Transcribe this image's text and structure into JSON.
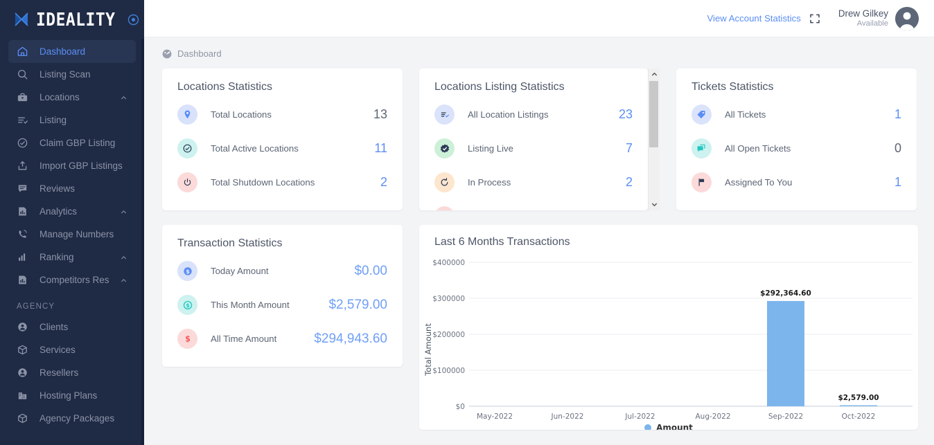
{
  "brand": {
    "name": "IDEALITY",
    "logo_icon": "ideality-x-logo",
    "target_icon": "target-icon"
  },
  "sidebar": {
    "items": [
      {
        "label": "Dashboard",
        "icon": "home-icon",
        "active": true,
        "caret": false
      },
      {
        "label": "Listing Scan",
        "icon": "search-icon",
        "active": false,
        "caret": false
      },
      {
        "label": "Locations",
        "icon": "briefcase-icon",
        "active": false,
        "caret": true
      },
      {
        "label": "Listing",
        "icon": "list-check-icon",
        "active": false,
        "caret": false
      },
      {
        "label": "Claim GBP Listing",
        "icon": "check-circle-icon",
        "active": false,
        "caret": false
      },
      {
        "label": "Import GBP Listings",
        "icon": "upload-box-icon",
        "active": false,
        "caret": false
      },
      {
        "label": "Reviews",
        "icon": "chat-icon",
        "active": false,
        "caret": false
      },
      {
        "label": "Analytics",
        "icon": "bar-chart-icon",
        "active": false,
        "caret": true
      },
      {
        "label": "Manage Numbers",
        "icon": "phone-icon",
        "active": false,
        "caret": false
      },
      {
        "label": "Ranking",
        "icon": "chart-bars-icon",
        "active": false,
        "caret": true
      },
      {
        "label": "Competitors Research",
        "icon": "report-icon",
        "active": false,
        "caret": true
      }
    ],
    "section_label": "AGENCY",
    "agency_items": [
      {
        "label": "Clients",
        "icon": "user-circle-icon",
        "caret": false
      },
      {
        "label": "Services",
        "icon": "box-icon",
        "caret": false
      },
      {
        "label": "Resellers",
        "icon": "user-circle-icon",
        "caret": false
      },
      {
        "label": "Hosting Plans",
        "icon": "server-building-icon",
        "caret": false
      },
      {
        "label": "Agency Packages",
        "icon": "box-icon",
        "caret": false
      }
    ]
  },
  "topbar": {
    "account_stats_label": "View Account Statistics",
    "expand_icon": "fullscreen-expand-icon",
    "user_name": "Drew Gilkey",
    "user_status": "Available",
    "avatar_icon": "user-avatar-icon"
  },
  "breadcrumb": {
    "icon": "dashboard-icon",
    "label": "Dashboard"
  },
  "cards": {
    "locations_statistics": {
      "title": "Locations Statistics",
      "rows": [
        {
          "label": "Total Locations",
          "value": "13",
          "icon": "map-pin-icon",
          "badge_bg": "#d9e2fb",
          "icon_color": "#5b8ef5",
          "value_color": "#4d5668"
        },
        {
          "label": "Total Active Locations",
          "value": "11",
          "icon": "check-circle-icon",
          "badge_bg": "#cdf2ef",
          "icon_color": "#2b3a55",
          "value_color": "#5b8ef5"
        },
        {
          "label": "Total Shutdown Locations",
          "value": "2",
          "icon": "power-icon",
          "badge_bg": "#fbdad9",
          "icon_color": "#2b3a55",
          "value_color": "#5b8ef5"
        }
      ]
    },
    "locations_listing_statistics": {
      "title": "Locations Listing Statistics",
      "rows": [
        {
          "label": "All Location Listings",
          "value": "23",
          "icon": "list-check-icon",
          "badge_bg": "#dbe3fb",
          "icon_color": "#2b3a55",
          "value_color": "#5b8ef5"
        },
        {
          "label": "Listing Live",
          "value": "7",
          "icon": "badge-check-icon",
          "badge_bg": "#cdf0d8",
          "icon_color": "#2b3a55",
          "value_color": "#5b8ef5"
        },
        {
          "label": "In Process",
          "value": "2",
          "icon": "refresh-icon",
          "badge_bg": "#fde6cd",
          "icon_color": "#2b3a55",
          "value_color": "#5b8ef5"
        },
        {
          "label": "",
          "value": "",
          "icon": "partial-row-icon",
          "badge_bg": "#fbdad9",
          "icon_color": "#2b3a55",
          "value_color": "#5b8ef5"
        }
      ],
      "scrollbar": {
        "up_icon": "chevron-up-icon",
        "down_icon": "chevron-down-icon"
      }
    },
    "tickets_statistics": {
      "title": "Tickets Statistics",
      "rows": [
        {
          "label": "All Tickets",
          "value": "1",
          "icon": "tag-icon",
          "badge_bg": "#dbe3fb",
          "icon_color": "#5b8ef5",
          "value_color": "#5b8ef5"
        },
        {
          "label": "All Open Tickets",
          "value": "0",
          "icon": "chat-bubbles-icon",
          "badge_bg": "#cdf2ef",
          "icon_color": "#22c7c0",
          "value_color": "#4d5668"
        },
        {
          "label": "Assigned To You",
          "value": "1",
          "icon": "flag-icon",
          "badge_bg": "#fbdad9",
          "icon_color": "#2b3a55",
          "value_color": "#5b8ef5"
        }
      ]
    },
    "transaction_statistics": {
      "title": "Transaction Statistics",
      "rows": [
        {
          "label": "Today Amount",
          "value": "$0.00",
          "icon": "dollar-circle-icon",
          "badge_bg": "#d9e2fb",
          "icon_color": "#5b8ef5",
          "value_color": "#6f9ff7"
        },
        {
          "label": "This Month Amount",
          "value": "$2,579.00",
          "icon": "dollar-circle-icon",
          "badge_bg": "#cdf2ef",
          "icon_color": "#22c7c0",
          "value_color": "#6f9ff7"
        },
        {
          "label": "All Time Amount",
          "value": "$294,943.60",
          "icon": "dollar-sign-icon",
          "badge_bg": "#fbdad9",
          "icon_color": "#f4565c",
          "value_color": "#6f9ff7"
        }
      ]
    }
  },
  "chart_data": {
    "type": "bar",
    "title": "Last 6 Months Transactions",
    "categories": [
      "May-2022",
      "Jun-2022",
      "Jul-2022",
      "Aug-2022",
      "Sep-2022",
      "Oct-2022"
    ],
    "values": [
      0,
      0,
      0,
      0,
      292364.6,
      2579.0
    ],
    "point_labels": [
      "",
      "",
      "",
      "",
      "$292,364.60",
      "$2,579.00"
    ],
    "xlabel": "",
    "ylabel": "Total Amount",
    "ylim": [
      0,
      400000
    ],
    "yticks": [
      "$0",
      "$100000",
      "$200000",
      "$300000",
      "$400000"
    ],
    "grid": true,
    "legend": [
      {
        "name": "Amount",
        "color": "#7cb5ec"
      }
    ],
    "legend_position": "bottom",
    "bar_color": "#7cb5ec"
  }
}
